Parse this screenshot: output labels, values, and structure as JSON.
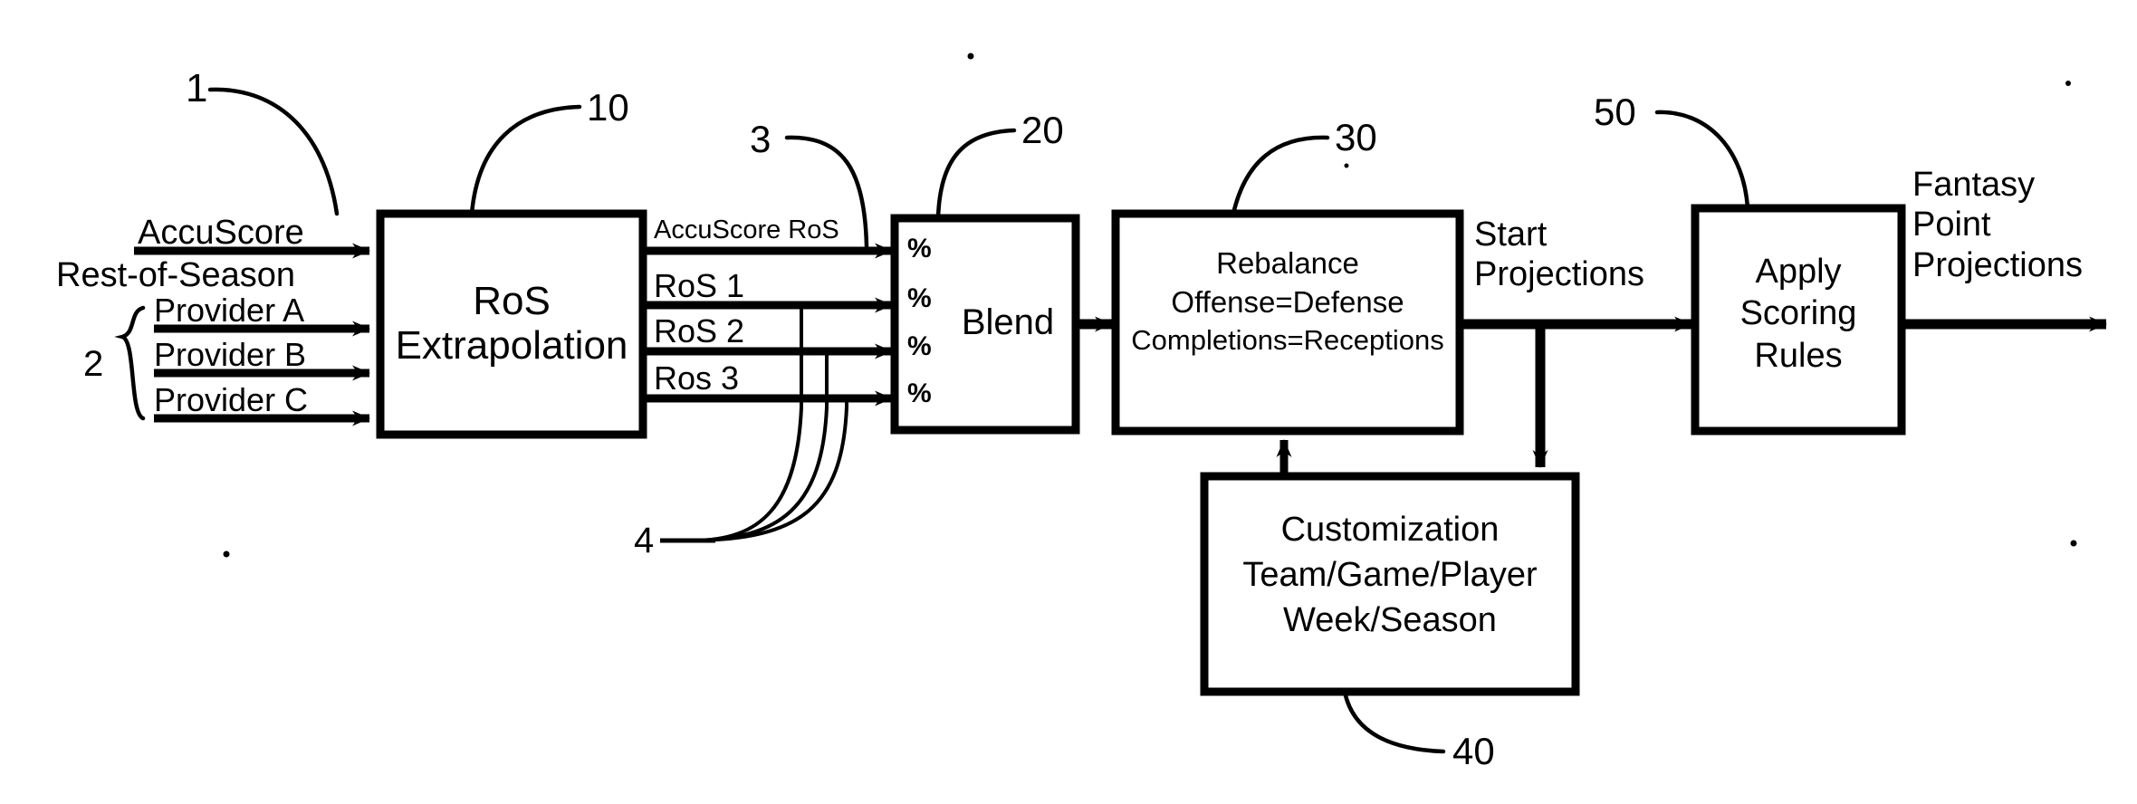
{
  "figure": {
    "type": "patent-flow-diagram",
    "title": "Fantasy point projection process flow"
  },
  "inputs": {
    "accuscore": {
      "line1": "AccuScore",
      "line2": "Rest-of-Season"
    },
    "providers": [
      {
        "label": "Provider A"
      },
      {
        "label": "Provider B"
      },
      {
        "label": "Provider C"
      }
    ],
    "provider_group_ref": "2"
  },
  "blocks": {
    "ros_extrapolation": {
      "line1": "RoS",
      "line2": "Extrapolation",
      "ref": "10"
    },
    "blend": {
      "label": "Blend",
      "ref": "20",
      "weights": [
        "%",
        "%",
        "%",
        "%"
      ]
    },
    "rebalance": {
      "line1": "Rebalance",
      "line2": "Offense=Defense",
      "line3": "Completions=Receptions",
      "ref": "30"
    },
    "customization": {
      "line1": "Customization",
      "line2": "Team/Game/Player",
      "line3": "Week/Season",
      "ref": "40"
    },
    "apply_scoring_rules": {
      "line1": "Apply",
      "line2": "Scoring",
      "line3": "Rules",
      "ref": "50"
    }
  },
  "intermediate_signals": {
    "accuscore_ros": "AccuScore RoS",
    "ros_1": "RoS 1",
    "ros_2": "RoS 2",
    "ros_3": "Ros 3",
    "group_ref": "4"
  },
  "flow_labels": {
    "start_projections": {
      "line1": "Start",
      "line2": "Projections"
    },
    "fantasy_point_projections": {
      "line1": "Fantasy",
      "line2": "Point",
      "line3": "Projections"
    }
  },
  "reference_numerals": {
    "input_stream": "1",
    "provider_bracket": "2",
    "ros_outputs": "3",
    "ros_output_group": "4",
    "ros_extrapolation": "10",
    "blend": "20",
    "rebalance": "30",
    "customization": "40",
    "apply_scoring_rules": "50"
  },
  "colors": {
    "ink": "#000000",
    "paper": "#ffffff"
  }
}
